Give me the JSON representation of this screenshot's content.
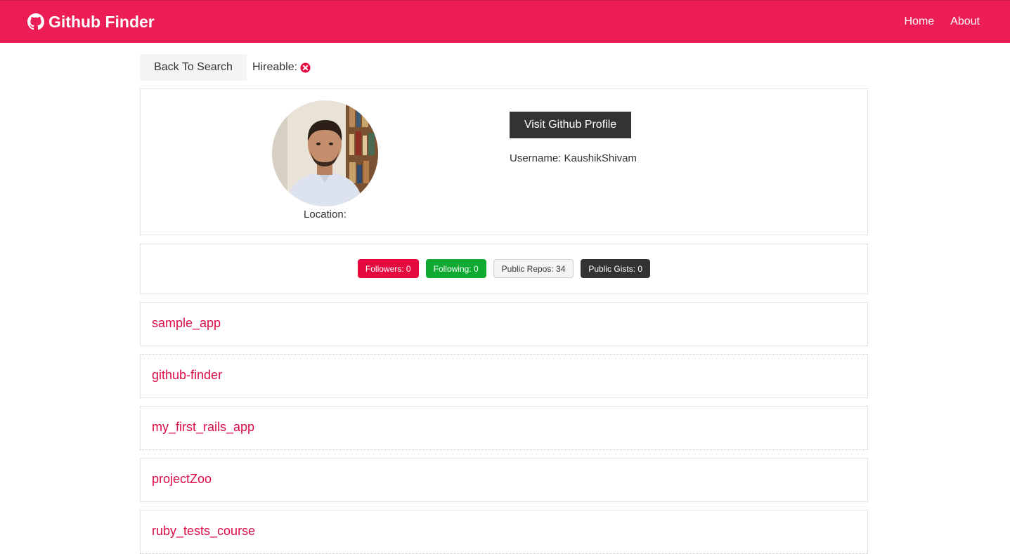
{
  "navbar": {
    "brand_icon": "github-icon",
    "brand": "Github Finder",
    "links": [
      {
        "label": "Home"
      },
      {
        "label": "About"
      }
    ],
    "bg_color": "#ec1c55"
  },
  "toolbar": {
    "back_label": "Back To Search",
    "hireable_label": "Hireable:",
    "hireable_icon": "times-circle-icon"
  },
  "profile": {
    "location_label": "Location:",
    "visit_label": "Visit Github Profile",
    "username_label": "Username: KaushikShivam"
  },
  "stats": {
    "followers": "Followers: 0",
    "following": "Following: 0",
    "repos": "Public Repos: 34",
    "gists": "Public Gists: 0"
  },
  "repos": [
    {
      "name": "sample_app"
    },
    {
      "name": "github-finder"
    },
    {
      "name": "my_first_rails_app"
    },
    {
      "name": "projectZoo"
    },
    {
      "name": "ruby_tests_course"
    }
  ]
}
